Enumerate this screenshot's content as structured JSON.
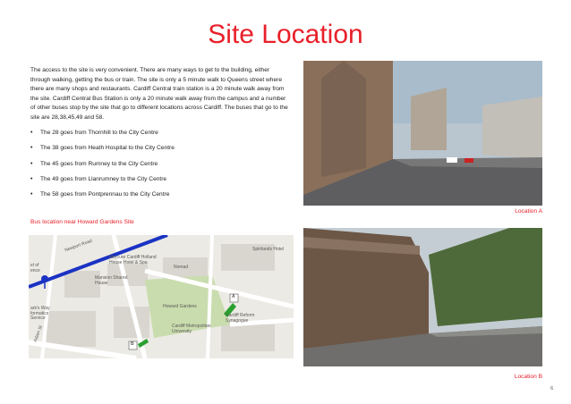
{
  "page": {
    "title": "Site Location",
    "intro": "The access to the site is very convenient. There are many ways to get to the      building, either through walking, getting the bus or train. The site is only a 5 minute walk to Queens street where there are many shops and restaurants. Cardiff Central train station is a 20 minute walk away from the site. Cardiff Central Bus Station is only a 20 minute walk away from the campus and a number of other buses stop by the site that go to different locations across Cardiff. The buses that go to the site are 28,38,45,49 and 58.",
    "bullet_symbol": "•",
    "bullets": [
      "The 28 goes from Thornhill to the City Centre",
      "The 38 goes from Heath Hospital to the City Centre",
      "The 45 goes from Rumney to the City Centre",
      "The 49 goes from Llanrumney to the City Centre",
      "The 58 goes from Pontprennau to the City Centre"
    ],
    "map_caption": "Bus location near Howard Gardens Site",
    "photo_a_caption": "Location A",
    "photo_b_caption": "Location B",
    "page_number": "6"
  },
  "map": {
    "labels": {
      "newport_road": "Newport Road",
      "mercure": "Mercure Cardiff Holland House Hotel & Spa",
      "mansion": "Mansion Shared House",
      "nomad": "Nomad",
      "howard_gardens": "Howard Gardens",
      "cardiff_met": "Cardiff Metropolitan University",
      "synagogue": "Cardiff Reform Synagogue",
      "spirilands": "Spirilands Hotel",
      "left_top": "el of ence",
      "left_mid": "ark's Way formatics Service",
      "adam_st": "Adam St",
      "marker_a": "A",
      "marker_b": "B"
    },
    "colors": {
      "road_highlight": "#1a33c4",
      "park": "#c9dcae",
      "building": "#d9d6cf",
      "street": "#ffffff",
      "marker": "#2aa030"
    }
  },
  "photos": {
    "a_description_icon": "street-photo-icon",
    "b_description_icon": "street-photo-icon"
  },
  "theme": {
    "accent": "#e8202a"
  }
}
